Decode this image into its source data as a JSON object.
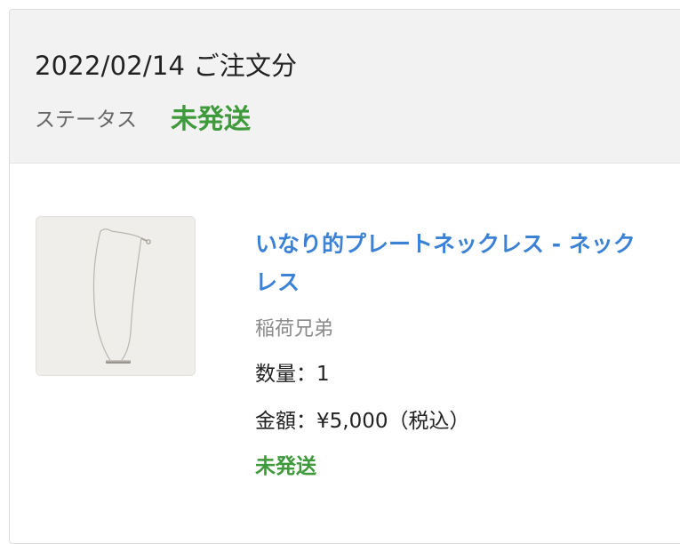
{
  "order": {
    "date_title": "2022/02/14 ご注文分",
    "status_label": "ステータス",
    "status_value": "未発送"
  },
  "item": {
    "title": "いなり的プレートネックレス - ネックレス",
    "brand": "稲荷兄弟",
    "quantity_text": "数量：1",
    "price_text": "金額：¥5,000（税込）",
    "status": "未発送",
    "image_icon": "necklace-product-photo"
  },
  "colors": {
    "header_bg": "#f2f2f2",
    "status_green": "#3e9a3a",
    "link_blue": "#3b82d6",
    "brand_gray": "#8a8a8a"
  }
}
